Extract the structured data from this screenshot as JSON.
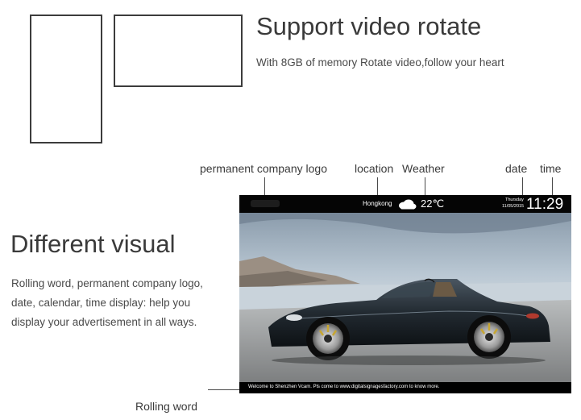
{
  "rotate": {
    "title": "Support video rotate",
    "description": "With 8GB of memory Rotate video,follow your heart"
  },
  "callouts": {
    "logo": "permanent company logo",
    "location": "location",
    "weather": "Weather",
    "date": "date",
    "time": "time",
    "rolling": "Rolling word"
  },
  "visual": {
    "title": "Different visual",
    "description": "Rolling word, permanent company logo, date, calendar, time display: help you display your advertisement in all ways."
  },
  "screen": {
    "location": "Hongkong",
    "weather_icon": "cloud-icon",
    "temperature": "22℃",
    "day": "Thursday",
    "date": "11/05/2015",
    "time": "11:29",
    "ticker": "Welcome to Shenzhen Vcam. Pls come to www.digitalsignagesfactory.com to know more.",
    "colors": {
      "bar": "#050505",
      "text": "#ffffff"
    }
  }
}
